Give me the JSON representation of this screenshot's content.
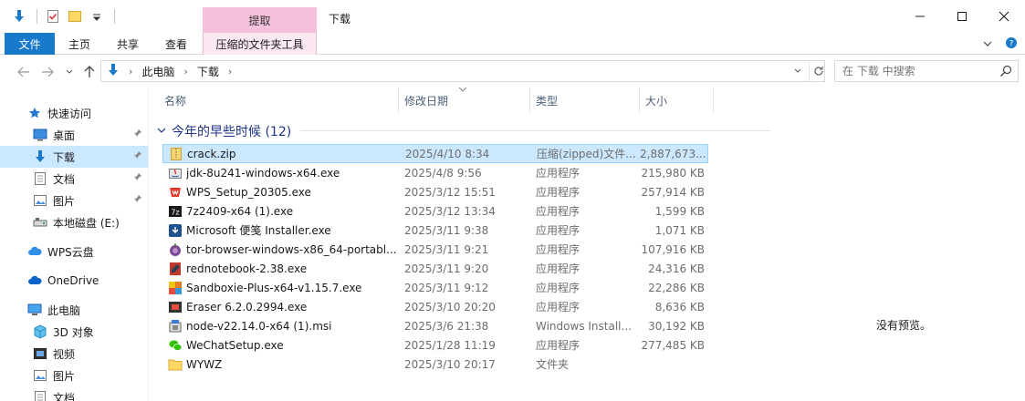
{
  "window": {
    "title": "下载",
    "context_tab": "提取"
  },
  "ribbon": {
    "tabs": [
      {
        "label": "文件"
      },
      {
        "label": "主页"
      },
      {
        "label": "共享"
      },
      {
        "label": "查看"
      },
      {
        "label": "压缩的文件夹工具"
      }
    ]
  },
  "address": {
    "crumbs": [
      "此电脑",
      "下载"
    ],
    "search_placeholder": "在 下载 中搜索"
  },
  "nav": {
    "items": [
      {
        "label": "快速访问",
        "icon": "star-icon"
      },
      {
        "label": "桌面",
        "icon": "desktop-icon"
      },
      {
        "label": "下载",
        "icon": "download-icon"
      },
      {
        "label": "文档",
        "icon": "document-icon"
      },
      {
        "label": "图片",
        "icon": "picture-icon"
      },
      {
        "label": "本地磁盘 (E:)",
        "icon": "drive-icon"
      },
      {
        "label": "WPS云盘",
        "icon": "cloud-icon"
      },
      {
        "label": "OneDrive",
        "icon": "onedrive-icon"
      },
      {
        "label": "此电脑",
        "icon": "computer-icon"
      },
      {
        "label": "3D 对象",
        "icon": "3d-objects-icon"
      },
      {
        "label": "视频",
        "icon": "video-icon"
      },
      {
        "label": "图片",
        "icon": "picture-icon"
      },
      {
        "label": "文档",
        "icon": "document-icon"
      }
    ]
  },
  "columns": {
    "name": "名称",
    "date": "修改日期",
    "type": "类型",
    "size": "大小"
  },
  "group": {
    "label": "今年的早些时候 (12)"
  },
  "files": [
    {
      "name": "crack.zip",
      "date": "2025/4/10 8:34",
      "type": "压缩(zipped)文件...",
      "size": "2,887,673...",
      "icon": "zip-folder-icon"
    },
    {
      "name": "jdk-8u241-windows-x64.exe",
      "date": "2025/4/8 9:56",
      "type": "应用程序",
      "size": "215,980 KB",
      "icon": "java-installer-icon"
    },
    {
      "name": "WPS_Setup_20305.exe",
      "date": "2025/3/12 15:51",
      "type": "应用程序",
      "size": "257,914 KB",
      "icon": "wps-icon"
    },
    {
      "name": "7z2409-x64 (1).exe",
      "date": "2025/3/12 13:34",
      "type": "应用程序",
      "size": "1,599 KB",
      "icon": "7zip-icon"
    },
    {
      "name": "Microsoft 便笺 Installer.exe",
      "date": "2025/3/11 9:38",
      "type": "应用程序",
      "size": "1,071 KB",
      "icon": "installer-download-icon"
    },
    {
      "name": "tor-browser-windows-x86_64-portabl...",
      "date": "2025/3/11 9:21",
      "type": "应用程序",
      "size": "107,916 KB",
      "icon": "tor-icon"
    },
    {
      "name": "rednotebook-2.38.exe",
      "date": "2025/3/11 9:20",
      "type": "应用程序",
      "size": "24,316 KB",
      "icon": "rednotebook-icon"
    },
    {
      "name": "Sandboxie-Plus-x64-v1.15.7.exe",
      "date": "2025/3/11 9:12",
      "type": "应用程序",
      "size": "22,286 KB",
      "icon": "sandboxie-icon"
    },
    {
      "name": "Eraser 6.2.0.2994.exe",
      "date": "2025/3/10 20:20",
      "type": "应用程序",
      "size": "8,636 KB",
      "icon": "eraser-icon"
    },
    {
      "name": "node-v22.14.0-x64 (1).msi",
      "date": "2025/3/6 21:38",
      "type": "Windows Install...",
      "size": "30,192 KB",
      "icon": "msi-icon"
    },
    {
      "name": "WeChatSetup.exe",
      "date": "2025/1/28 11:19",
      "type": "应用程序",
      "size": "277,485 KB",
      "icon": "wechat-icon"
    },
    {
      "name": "WYWZ",
      "date": "2025/3/10 20:17",
      "type": "文件夹",
      "size": "",
      "icon": "folder-icon"
    }
  ],
  "preview": {
    "message": "没有预览。"
  },
  "colors": {
    "accent": "#1979ca",
    "selection": "#cce8ff",
    "context_tab": "#f5c0dc",
    "group_header": "#1e3287"
  }
}
